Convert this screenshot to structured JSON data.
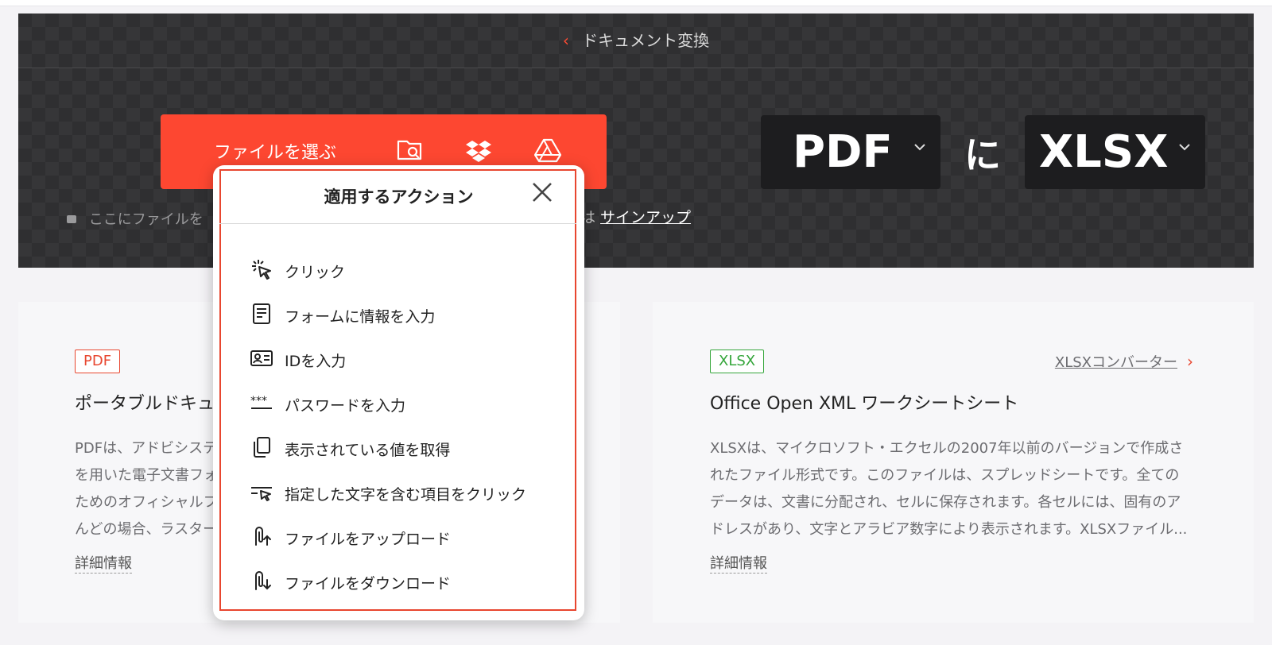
{
  "header": {
    "back_chevron": "‹",
    "title": "ドキュメント変換"
  },
  "uploader": {
    "choose_label": "ファイルを選ぶ",
    "icons": [
      "folder-search-icon",
      "dropbox-icon",
      "google-drive-icon"
    ],
    "privacy_text": "ここにファイルを",
    "signup_prefix": "は",
    "signup_link": "サインアップ"
  },
  "converter": {
    "from_format": "PDF",
    "to_word": "に",
    "to_format": "XLSX"
  },
  "cards": {
    "left": {
      "badge": "PDF",
      "title": "ポータブルドキュ",
      "desc": [
        "PDFは、アドビシステ",
        "を用いた電子文書フォ",
        "ためのオフィシャルフ",
        "んどの場合、ラスター"
      ],
      "more": "詳細情報"
    },
    "right": {
      "badge": "XLSX",
      "converter_link": "XLSXコンバーター",
      "title": "Office Open XML ワークシートシート",
      "desc": [
        "XLSXは、マイクロソフト・エクセルの2007年以前のバージョンで作成さ",
        "れたファイル形式です。このファイルは、スプレッドシートです。全ての",
        "データは、文書に分配され、セルに保存されます。各セルには、固有のア",
        "ドレスがあり、文字とアラビア数字により表示されます。XLSXファイル..."
      ],
      "more": "詳細情報"
    }
  },
  "popup": {
    "title": "適用するアクション",
    "close_icon": "close-icon",
    "actions": [
      {
        "label": "クリック",
        "icon": "click-icon"
      },
      {
        "label": "フォームに情報を入力",
        "icon": "form-icon"
      },
      {
        "label": "IDを入力",
        "icon": "id-card-icon"
      },
      {
        "label": "パスワードを入力",
        "icon": "password-icon"
      },
      {
        "label": "表示されている値を取得",
        "icon": "copy-icon"
      },
      {
        "label": "指定した文字を含む項目をクリック",
        "icon": "text-click-icon"
      },
      {
        "label": "ファイルをアップロード",
        "icon": "upload-clip-icon"
      },
      {
        "label": "ファイルをダウンロード",
        "icon": "download-clip-icon"
      }
    ]
  },
  "colors": {
    "accent": "#fd4731",
    "hero_bg": "#2f2f31",
    "xlsx_green": "#35a63b"
  }
}
